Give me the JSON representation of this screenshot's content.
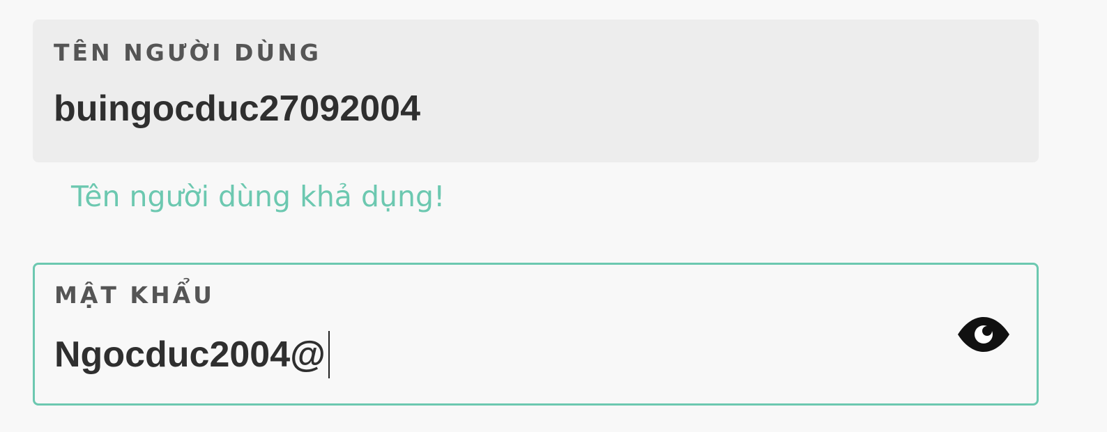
{
  "username_field": {
    "label": "TÊN NGƯỜI DÙNG",
    "value": "buingocduc27092004"
  },
  "availability_message": "Tên người dùng khả dụng!",
  "password_field": {
    "label": "MẬT KHẨU",
    "value": "Ngocduc2004@",
    "toggle_icon": "eye-icon"
  },
  "colors": {
    "accent": "#6cc8b0",
    "label": "#555555",
    "text": "#2f2f2f"
  }
}
